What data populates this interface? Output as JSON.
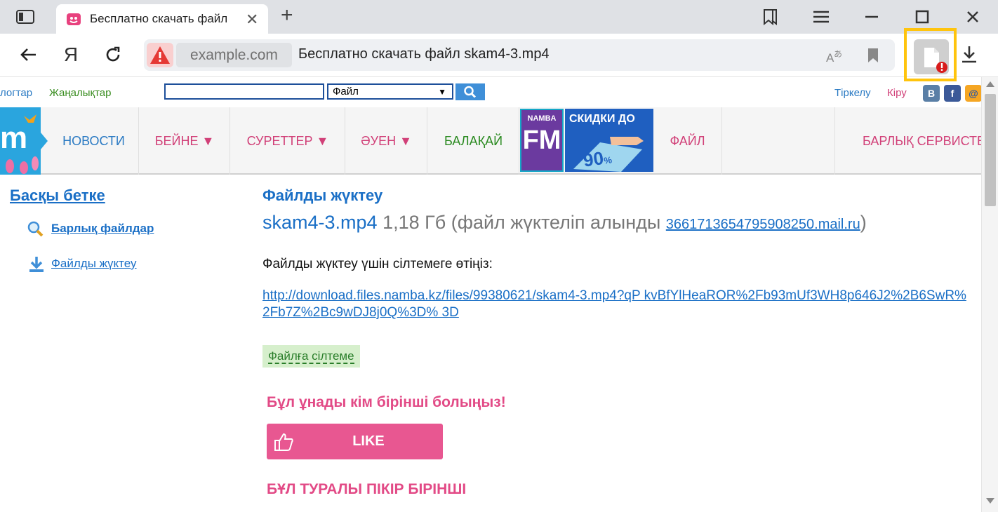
{
  "browser": {
    "tab_title": "Бесплатно скачать файл",
    "tab_close": "✕",
    "new_tab": "+",
    "domain": "example.com",
    "page_title": "Бесплатно скачать файл skam4-3.mp4",
    "yandex_label": "Я"
  },
  "site": {
    "top": {
      "link_left": "логтар",
      "news": "Жаңалықтар",
      "search_value": "",
      "select_value": "Файл",
      "register": "Тіркелу",
      "login": "Кіру",
      "vk": "B",
      "fb": "f",
      "mail": "@"
    },
    "nav": {
      "news": "НОВОСТИ",
      "video": "БЕЙНЕ ▼",
      "photos": "СУРЕТТЕР ▼",
      "music": "ӘУЕН ▼",
      "kids": "БАЛАҚАЙ",
      "fm_top": "NAMBA",
      "fm_big": "FM",
      "sale_top": "СКИДКИ ДО",
      "sale_value": "90",
      "sale_pct": "%",
      "file": "ФАЙЛ",
      "all_services": "БАРЛЫҚ СЕРВИСТЕР"
    },
    "left": {
      "back": "Басқы бетке",
      "all_files": "Барлық файлдар",
      "upload": "Файлды жүктеу"
    },
    "main": {
      "heading": "Файлды жүктеу",
      "file_name": "skam4-3.mp4",
      "file_size": "1,18 Гб",
      "uploaded_by": "(файл жүктеліп алынды",
      "owner": "3661713654795908250.mail.ru",
      "close_paren": ")",
      "instruction": "Файлды жүктеу үшін сілтемеге өтіңіз:",
      "download_url": "http://download.files.namba.kz/files/99380621/skam4-3.mp4?qP kvBfYlHeaROR%2Fb93mUf3WH8p646J2%2B6SwR%2Fb7Z%2Bc9wDJ8j0Q%3D% 3D",
      "file_ref": "Файлға сілтеме",
      "like_title": "Бұл ұнады кім бірінші болыңыз!",
      "like_label": "LIKE",
      "comment_title": "БҰЛ ТУРАЛЫ ПІКІР БІРІНШІ"
    }
  },
  "colors": {
    "accent_blue": "#1a6fc6",
    "pink": "#e85791",
    "highlight": "#ffc40d"
  }
}
